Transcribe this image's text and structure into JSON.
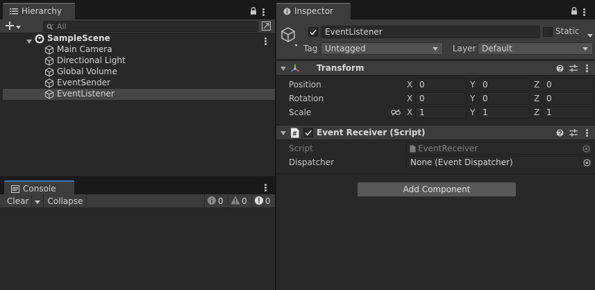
{
  "hierarchy": {
    "tab_label": "Hierarchy",
    "search_placeholder": "All",
    "scene": "SampleScene",
    "items": [
      {
        "label": "Main Camera"
      },
      {
        "label": "Directional Light"
      },
      {
        "label": "Global Volume"
      },
      {
        "label": "EventSender"
      },
      {
        "label": "EventListener",
        "selected": true
      }
    ]
  },
  "console": {
    "tab_label": "Console",
    "clear_label": "Clear",
    "collapse_label": "Collapse",
    "info_count": "0",
    "warning_count": "0",
    "error_count": "0"
  },
  "inspector": {
    "tab_label": "Inspector",
    "object_name": "EventListener",
    "static_label": "Static",
    "tag_label": "Tag",
    "tag_value": "Untagged",
    "layer_label": "Layer",
    "layer_value": "Default",
    "transform": {
      "title": "Transform",
      "x": "X",
      "y": "Y",
      "z": "Z",
      "position_label": "Position",
      "position": {
        "x": "0",
        "y": "0",
        "z": "0"
      },
      "rotation_label": "Rotation",
      "rotation": {
        "x": "0",
        "y": "0",
        "z": "0"
      },
      "scale_label": "Scale",
      "scale": {
        "x": "1",
        "y": "1",
        "z": "1"
      }
    },
    "event_receiver": {
      "title": "Event Receiver (Script)",
      "script_label": "Script",
      "script_value": "EventReceiver",
      "dispatcher_label": "Dispatcher",
      "dispatcher_value": "None (Event Dispatcher)"
    },
    "add_component_label": "Add Component"
  },
  "colors": {
    "accent": "#3a79bb",
    "panel": "#282828",
    "header": "#3c3c3c",
    "selection": "#464646"
  },
  "icons": [
    "list-icon",
    "lock-icon",
    "menu-dots-icon",
    "plus-icon",
    "search-icon",
    "unity-scene-icon",
    "gameobject-cube-icon",
    "info-icon",
    "console-icon",
    "transform-icon",
    "script-icon",
    "help-icon",
    "preset-icon",
    "link-icon",
    "object-picker-icon",
    "warning-icon",
    "error-icon"
  ]
}
